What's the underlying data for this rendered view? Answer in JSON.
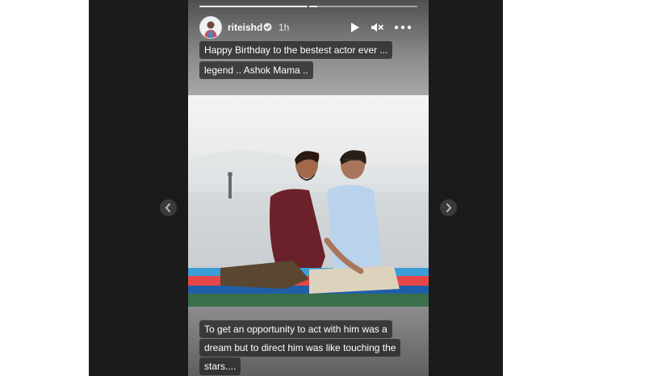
{
  "story": {
    "username": "riteishd",
    "time": "1h",
    "caption_top": [
      "Happy Birthday to the bestest actor ever ...",
      "legend .. Ashok Mama .."
    ],
    "caption_bottom": [
      "To get an opportunity to act with him was a",
      "dream but to direct him was like touching the",
      "stars...."
    ]
  },
  "icons": {
    "play": "play-icon",
    "mute": "speaker-muted-icon",
    "more": "more-options-icon",
    "verified": "verified-badge-icon",
    "prev": "chevron-left-icon",
    "next": "chevron-right-icon"
  },
  "colors": {
    "viewer_bg": "#1b1b1b",
    "caption_bg": "#282828",
    "text": "#ffffff"
  }
}
